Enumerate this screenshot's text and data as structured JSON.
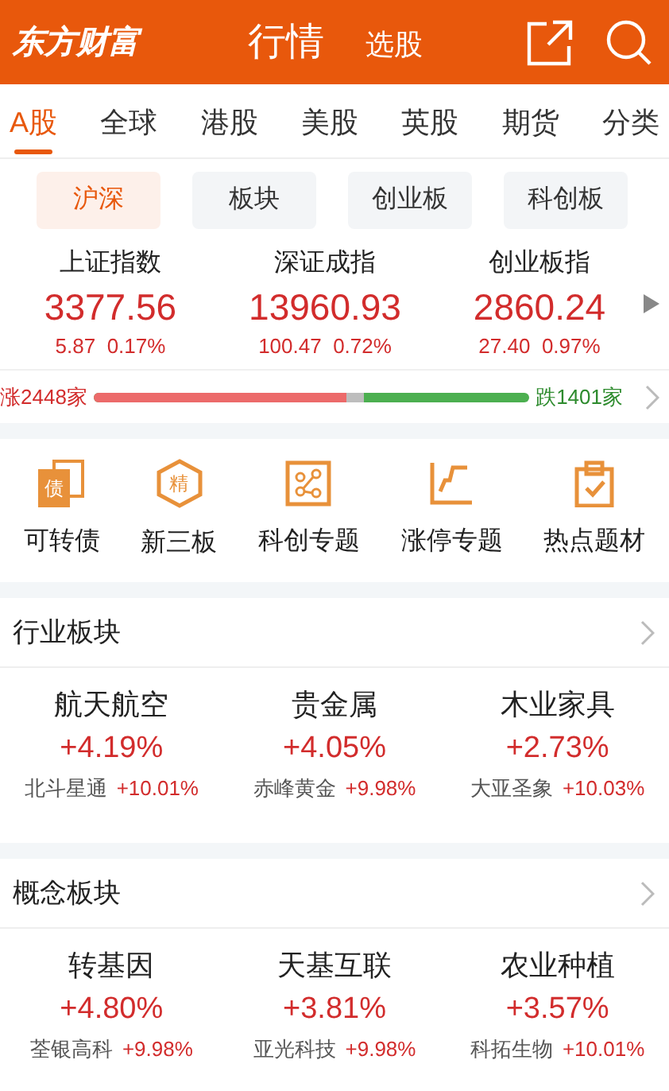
{
  "header": {
    "logo": "东方财富",
    "tabs": [
      {
        "label": "行情",
        "selected": true
      },
      {
        "label": "选股",
        "selected": false
      }
    ]
  },
  "market_tabs": [
    {
      "label": "A股",
      "selected": true
    },
    {
      "label": "全球",
      "selected": false
    },
    {
      "label": "港股",
      "selected": false
    },
    {
      "label": "美股",
      "selected": false
    },
    {
      "label": "英股",
      "selected": false
    },
    {
      "label": "期货",
      "selected": false
    },
    {
      "label": "分类",
      "selected": false
    }
  ],
  "sub_tabs": [
    {
      "label": "沪深",
      "selected": true
    },
    {
      "label": "板块",
      "selected": false
    },
    {
      "label": "创业板",
      "selected": false
    },
    {
      "label": "科创板",
      "selected": false
    }
  ],
  "indices": [
    {
      "name": "上证指数",
      "value": "3377.56",
      "change": "5.87",
      "percent": "0.17%"
    },
    {
      "name": "深证成指",
      "value": "13960.93",
      "change": "100.47",
      "percent": "0.72%"
    },
    {
      "name": "创业板指",
      "value": "2860.24",
      "change": "27.40",
      "percent": "0.97%"
    }
  ],
  "breadth": {
    "up": "涨2448家",
    "down": "跌1401家",
    "level": 0.58
  },
  "shortcuts": [
    {
      "kind": "bond",
      "glyph": "债",
      "label": "可转债"
    },
    {
      "kind": "hexagon",
      "glyph": "精",
      "label": "新三板"
    },
    {
      "kind": "nodes",
      "label": "科创专题"
    },
    {
      "kind": "step",
      "label": "涨停专题"
    },
    {
      "kind": "clipboard",
      "label": "热点题材"
    }
  ],
  "sections": [
    {
      "title": "行业板块",
      "items": [
        {
          "name": "航天航空",
          "change": "+4.19%",
          "leader": "北斗星通",
          "leader_change": "+10.01%"
        },
        {
          "name": "贵金属",
          "change": "+4.05%",
          "leader": "赤峰黄金",
          "leader_change": "+9.98%"
        },
        {
          "name": "木业家具",
          "change": "+2.73%",
          "leader": "大亚圣象",
          "leader_change": "+10.03%"
        }
      ]
    },
    {
      "title": "概念板块",
      "items": [
        {
          "name": "转基因",
          "change": "+4.80%",
          "leader": "荃银高科",
          "leader_change": "+9.98%"
        },
        {
          "name": "天基互联",
          "change": "+3.81%",
          "leader": "亚光科技",
          "leader_change": "+9.98%"
        },
        {
          "name": "农业种植",
          "change": "+3.57%",
          "leader": "科拓生物",
          "leader_change": "+10.01%"
        }
      ]
    }
  ]
}
